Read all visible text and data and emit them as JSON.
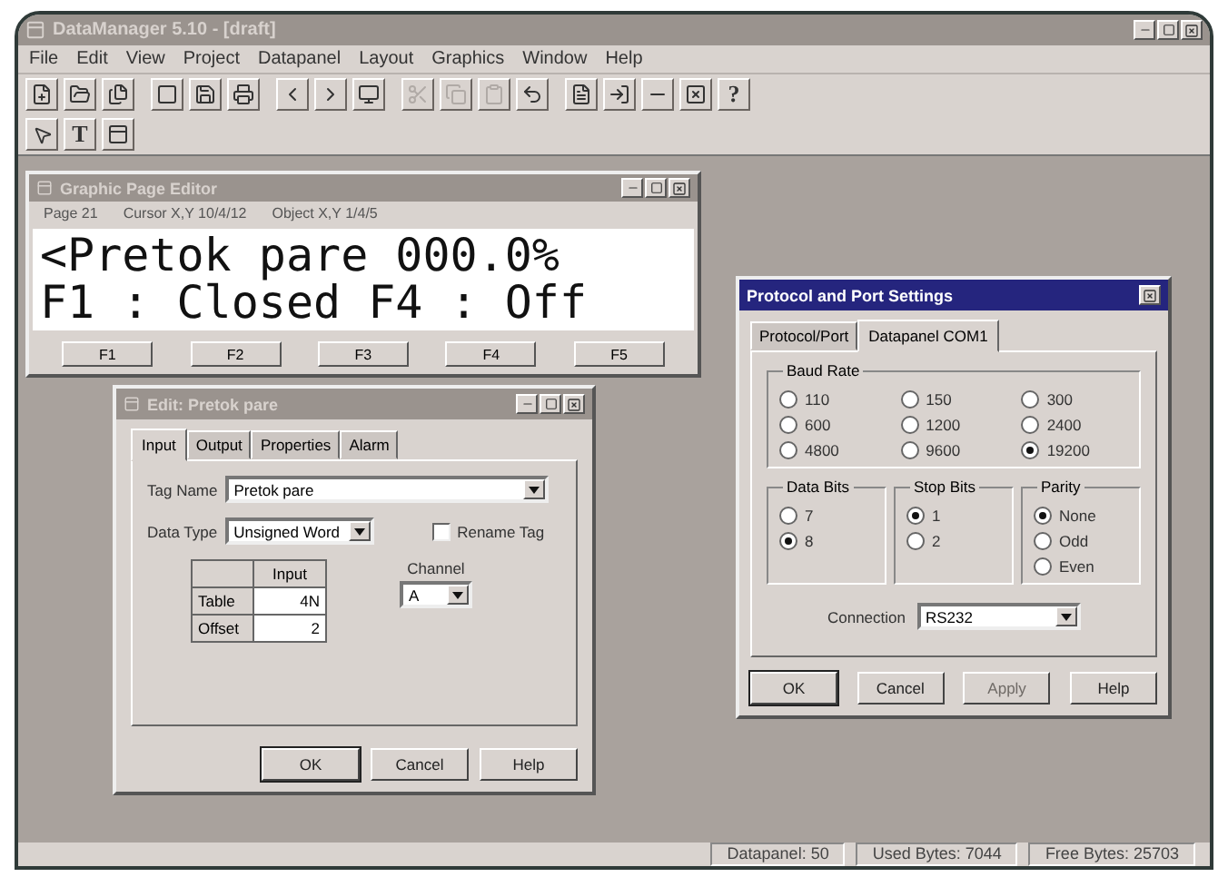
{
  "window": {
    "title": "DataManager 5.10 - [draft]"
  },
  "menu": [
    "File",
    "Edit",
    "View",
    "Project",
    "Datapanel",
    "Layout",
    "Graphics",
    "Window",
    "Help"
  ],
  "toolbar": {
    "help_label": "?"
  },
  "tools": {
    "text_label": "T"
  },
  "graphic_editor": {
    "title": "Graphic Page Editor",
    "info": [
      {
        "label": "Page",
        "value": "21"
      },
      {
        "label": "Cursor X,Y",
        "value": "10/4/12"
      },
      {
        "label": "Object X,Y",
        "value": "1/4/5"
      }
    ],
    "lines": [
      "<Pretok pare 000.0%",
      "F1 : Closed F4 : Off"
    ],
    "keys": [
      "F1",
      "F2",
      "F3",
      "F4",
      "F5"
    ]
  },
  "tag_dialog": {
    "title": "Edit: Pretok pare",
    "tabs": [
      {
        "label": "Input",
        "selected": true
      },
      {
        "label": "Output",
        "selected": false
      },
      {
        "label": "Properties",
        "selected": false
      },
      {
        "label": "Alarm",
        "selected": false
      }
    ],
    "tag_name": {
      "label": "Tag Name",
      "value": "Pretok pare"
    },
    "data_type": {
      "label": "Data Type",
      "value": "Unsigned Word"
    },
    "option": {
      "label": "Rename Tag",
      "checked": false
    },
    "table": {
      "header": "Input",
      "rows": [
        {
          "label": "Table",
          "value": "4N"
        },
        {
          "label": "Offset",
          "value": "2"
        }
      ]
    },
    "channel": {
      "label": "Channel",
      "value": "A"
    },
    "buttons": [
      "OK",
      "Cancel",
      "Help"
    ]
  },
  "port_dialog": {
    "title": "Protocol and Port Settings",
    "tabs": [
      {
        "label": "Protocol/Port",
        "selected": false
      },
      {
        "label": "Datapanel COM1",
        "selected": true
      }
    ],
    "baud": {
      "label": "Baud Rate",
      "options": [
        {
          "label": "110",
          "selected": false
        },
        {
          "label": "150",
          "selected": false
        },
        {
          "label": "300",
          "selected": false
        },
        {
          "label": "600",
          "selected": false
        },
        {
          "label": "1200",
          "selected": false
        },
        {
          "label": "2400",
          "selected": false
        },
        {
          "label": "4800",
          "selected": false
        },
        {
          "label": "9600",
          "selected": false
        },
        {
          "label": "19200",
          "selected": true
        }
      ]
    },
    "groups": [
      {
        "label": "Data Bits",
        "options": [
          {
            "label": "7",
            "selected": false
          },
          {
            "label": "8",
            "selected": true
          }
        ]
      },
      {
        "label": "Stop Bits",
        "options": [
          {
            "label": "1",
            "selected": true
          },
          {
            "label": "2",
            "selected": false
          }
        ]
      },
      {
        "label": "Parity",
        "options": [
          {
            "label": "None",
            "selected": true
          },
          {
            "label": "Odd",
            "selected": false
          },
          {
            "label": "Even",
            "selected": false
          }
        ]
      }
    ],
    "connection": {
      "label": "Connection",
      "value": "RS232"
    },
    "buttons": [
      {
        "label": "OK",
        "disabled": false
      },
      {
        "label": "Cancel",
        "disabled": false
      },
      {
        "label": "Apply",
        "disabled": true
      },
      {
        "label": "Help",
        "disabled": false
      }
    ]
  },
  "status_bar": [
    {
      "label": "Datapanel:",
      "value": "50"
    },
    {
      "label": "Used Bytes:",
      "value": "7044"
    },
    {
      "label": "Free Bytes:",
      "value": "25703"
    }
  ]
}
